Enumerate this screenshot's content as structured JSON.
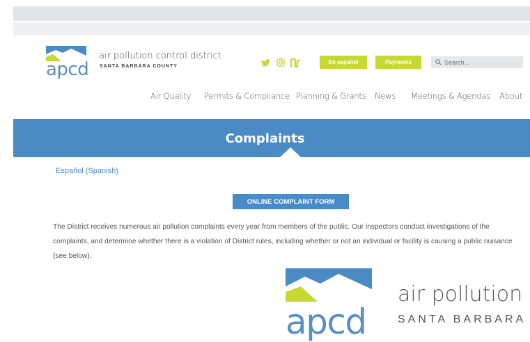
{
  "header": {
    "logo_text": "apcd",
    "district_name": "air pollution control district",
    "county_name": "SANTA BARBARA COUNTY",
    "social_icons": [
      "twitter-icon",
      "instagram-icon",
      "nextdoor-icon"
    ],
    "espanol_label": "En español",
    "payments_label": "Payments",
    "search_placeholder": "Search..."
  },
  "nav": {
    "items": [
      "Air Quality",
      "Permits & Compliance",
      "Planning & Grants",
      "News",
      "Meetings & Agendas",
      "About"
    ]
  },
  "banner": {
    "title": "Complaints"
  },
  "content": {
    "spanish_link": "Español (Spanish)",
    "complaint_button": "ONLINE COMPLAINT FORM",
    "paragraph": "The District receives numerous air pollution complaints every year from members of the public. Our inspectors conduct investigations of the complaints, and determine whether there is a violation of District rules, including whether or not an individual or facility is causing a public nuisance (see below).",
    "big_logo_text": "apcd",
    "big_district_name": "air pollution c",
    "big_county_name": "SANTA BARBARA C"
  },
  "colors": {
    "brand_blue": "#4a8bc5",
    "accent_yellow": "#c8d832"
  }
}
